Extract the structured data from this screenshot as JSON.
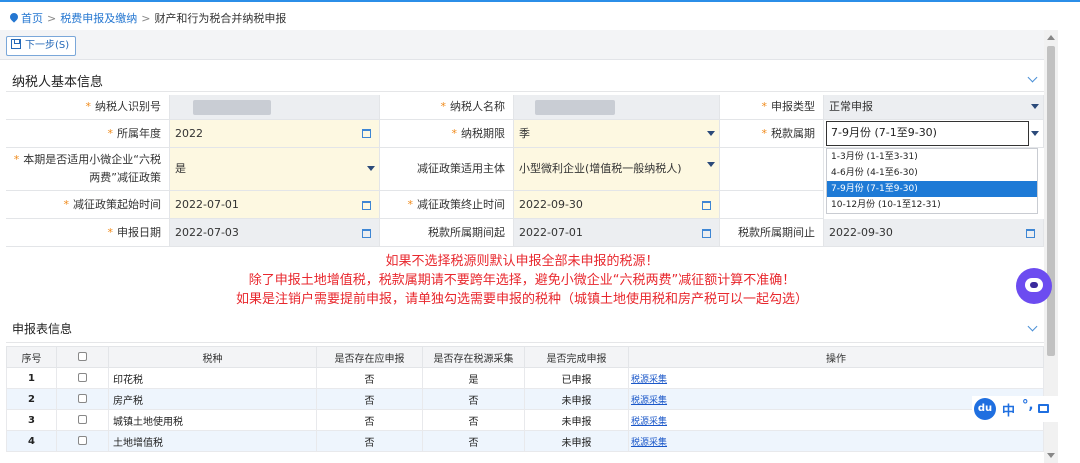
{
  "breadcrumb": {
    "home": "首页",
    "level2": "税费申报及缴纳",
    "current": "财产和行为税合并纳税申报",
    "separator": ">"
  },
  "toolbar": {
    "next_label": "下一步(S)"
  },
  "basic_info": {
    "title": "纳税人基本信息",
    "taxpayer_id_label": "纳税人识别号",
    "taxpayer_name_label": "纳税人名称",
    "declare_type_label": "申报类型",
    "declare_type_value": "正常申报",
    "year_label": "所属年度",
    "year_value": "2022",
    "period_label": "纳税期限",
    "period_value": "季",
    "tax_period_label": "税款属期",
    "tax_period_value": "7-9月份 (7-1至9-30)",
    "tax_period_options": [
      "1-3月份 (1-1至3-31)",
      "4-6月份 (4-1至6-30)",
      "7-9月份 (7-1至9-30)",
      "10-12月份 (10-1至12-31)"
    ],
    "tax_period_selected_index": 2,
    "small_enterprise_label_line1": "本期是否适用小微企业“六税",
    "small_enterprise_label_line2": "两费”减征政策",
    "small_enterprise_value": "是",
    "reduction_subject_label": "减征政策适用主体",
    "reduction_subject_value": "小型微利企业(增值税一般纳税人)",
    "reduction_start_label": "减征政策起始时间",
    "reduction_start_value": "2022-07-01",
    "reduction_end_label": "减征政策终止时间",
    "reduction_end_value": "2022-09-30",
    "declare_date_label": "申报日期",
    "declare_date_value": "2022-07-03",
    "period_start_label": "税款所属期间起",
    "period_start_value": "2022-07-01",
    "period_end_label": "税款所属期间止",
    "period_end_value": "2022-09-30"
  },
  "warnings": [
    "如果不选择税源则默认申报全部未申报的税源！",
    "除了申报土地增值税，税款属期请不要跨年选择，避免小微企业“六税两费”减征额计算不准确！",
    "如果是注销户需要提前申报，请单独勾选需要申报的税种（城镇土地使用税和房产税可以一起勾选）"
  ],
  "declaration": {
    "title": "申报表信息",
    "columns": [
      "序号",
      "税种",
      "是否存在应申报",
      "是否存在税源采集",
      "是否完成申报",
      "操作"
    ],
    "rows": [
      {
        "no": "1",
        "tax": "印花税",
        "should": "否",
        "source": "是",
        "status": "已申报",
        "action": "税源采集"
      },
      {
        "no": "2",
        "tax": "房产税",
        "should": "否",
        "source": "否",
        "status": "未申报",
        "action": "税源采集"
      },
      {
        "no": "3",
        "tax": "城镇土地使用税",
        "should": "否",
        "source": "否",
        "status": "未申报",
        "action": "税源采集"
      },
      {
        "no": "4",
        "tax": "土地增值税",
        "should": "否",
        "source": "否",
        "status": "未申报",
        "action": "税源采集"
      }
    ]
  },
  "ime": {
    "logo": "du",
    "lang": "中",
    "punct": "°,"
  },
  "colors": {
    "accent": "#2577d1",
    "warning": "#e8272d",
    "required": "#f08a1a",
    "selected": "#1e7ad6"
  }
}
